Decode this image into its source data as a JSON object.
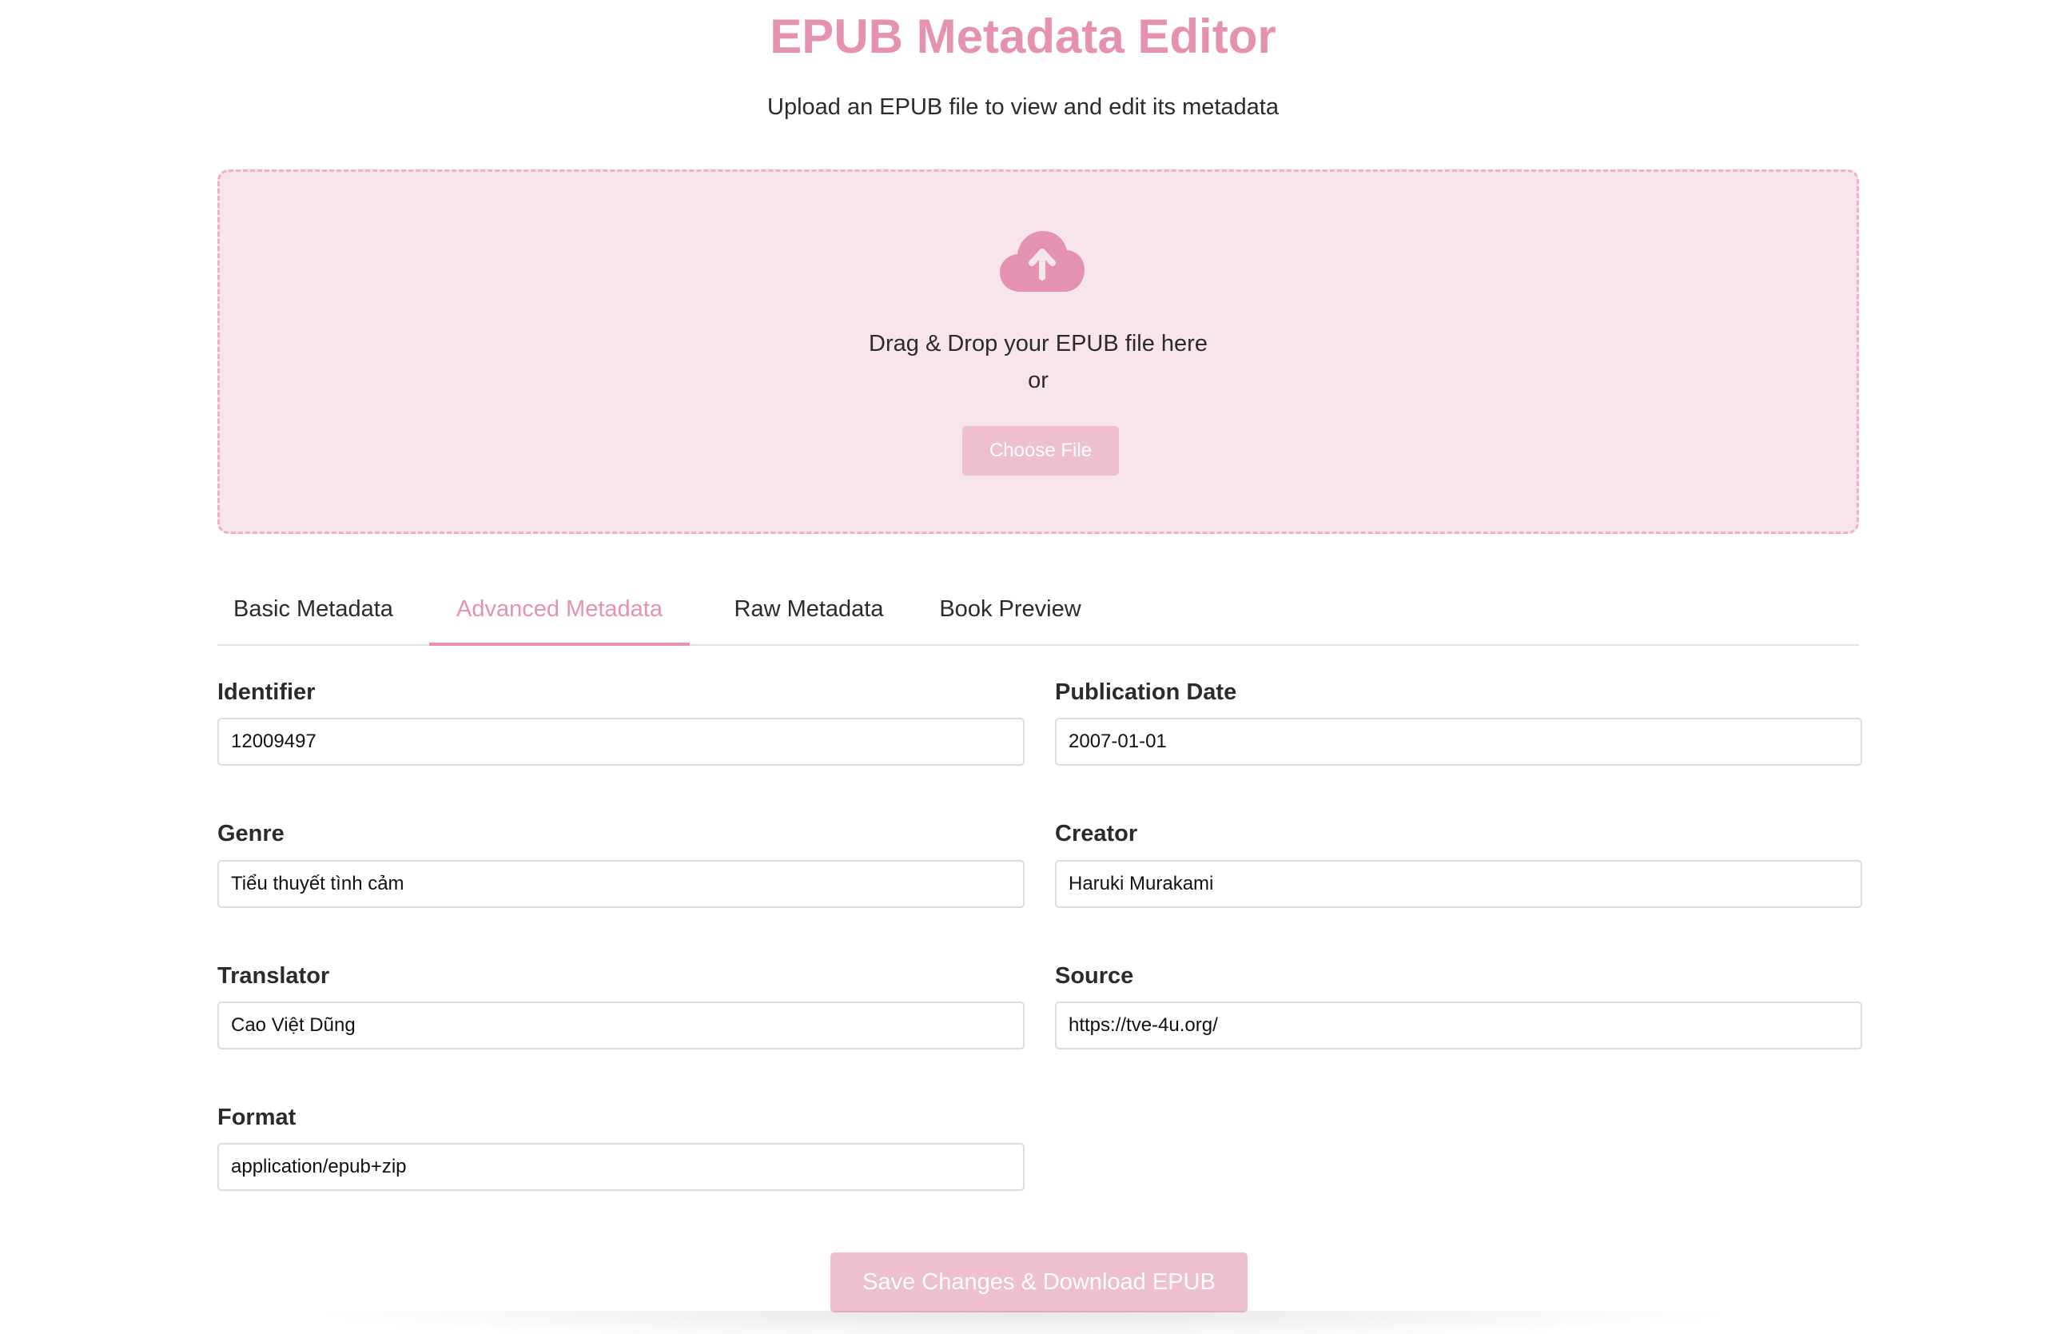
{
  "header": {
    "title": "EPUB Metadata Editor",
    "subtitle": "Upload an EPUB file to view and edit its metadata"
  },
  "upload": {
    "icon": "cloud-upload-icon",
    "drag_text": "Drag & Drop your EPUB file here",
    "or_text": "or",
    "choose_label": "Choose File"
  },
  "tabs": [
    {
      "label": "Basic Metadata",
      "active": false
    },
    {
      "label": "Advanced Metadata",
      "active": true
    },
    {
      "label": "Raw Metadata",
      "active": false
    },
    {
      "label": "Book Preview",
      "active": false
    }
  ],
  "fields": {
    "identifier": {
      "label": "Identifier",
      "value": "12009497"
    },
    "publication_date": {
      "label": "Publication Date",
      "value": "2007-01-01"
    },
    "genre": {
      "label": "Genre",
      "value": "Tiểu thuyết tình cảm"
    },
    "creator": {
      "label": "Creator",
      "value": "Haruki Murakami"
    },
    "translator": {
      "label": "Translator",
      "value": "Cao Việt Dũng"
    },
    "source": {
      "label": "Source",
      "value": "https://tve-4u.org/"
    },
    "format": {
      "label": "Format",
      "value": "application/epub+zip"
    }
  },
  "actions": {
    "save_label": "Save Changes & Download EPUB"
  },
  "colors": {
    "accent": "#e591b2",
    "dropzone_bg": "#f8e5ec",
    "button_bg": "#eebfd0"
  }
}
